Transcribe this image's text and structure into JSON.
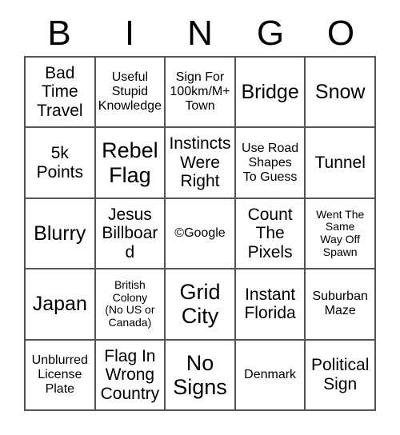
{
  "card": {
    "header_letters": [
      "B",
      "I",
      "N",
      "G",
      "O"
    ],
    "rows": [
      [
        {
          "text": "Bad\nTime\nTravel",
          "size": "fs-md"
        },
        {
          "text": "Useful\nStupid\nKnowledge",
          "size": "fs-sm"
        },
        {
          "text": "Sign For\n100km/M+\nTown",
          "size": "fs-sm"
        },
        {
          "text": "Bridge",
          "size": "fs-lg"
        },
        {
          "text": "Snow",
          "size": "fs-lg"
        }
      ],
      [
        {
          "text": "5k\nPoints",
          "size": "fs-md"
        },
        {
          "text": "Rebel\nFlag",
          "size": "fs-xl"
        },
        {
          "text": "Instincts\nWere\nRight",
          "size": "fs-md"
        },
        {
          "text": "Use Road\nShapes\nTo Guess",
          "size": "fs-sm"
        },
        {
          "text": "Tunnel",
          "size": "fs-md"
        }
      ],
      [
        {
          "text": "Blurry",
          "size": "fs-lg"
        },
        {
          "text": "Jesus\nBillboard",
          "size": "fs-md"
        },
        {
          "text": "©Google",
          "size": "fs-sm"
        },
        {
          "text": "Count\nThe\nPixels",
          "size": "fs-md"
        },
        {
          "text": "Went The\nSame\nWay Off\nSpawn",
          "size": "fs-xs"
        }
      ],
      [
        {
          "text": "Japan",
          "size": "fs-lg"
        },
        {
          "text": "British\nColony\n(No US or\nCanada)",
          "size": "fs-xs"
        },
        {
          "text": "Grid\nCity",
          "size": "fs-xl"
        },
        {
          "text": "Instant\nFlorida",
          "size": "fs-md"
        },
        {
          "text": "Suburban\nMaze",
          "size": "fs-sm"
        }
      ],
      [
        {
          "text": "Unblurred\nLicense\nPlate",
          "size": "fs-sm"
        },
        {
          "text": "Flag In\nWrong\nCountry",
          "size": "fs-md"
        },
        {
          "text": "No\nSigns",
          "size": "fs-xl"
        },
        {
          "text": "Denmark",
          "size": "fs-sm"
        },
        {
          "text": "Political\nSign",
          "size": "fs-md"
        }
      ]
    ]
  },
  "colors": {
    "background": "#ffffff",
    "text": "#000000",
    "grid_line": "#555555"
  }
}
